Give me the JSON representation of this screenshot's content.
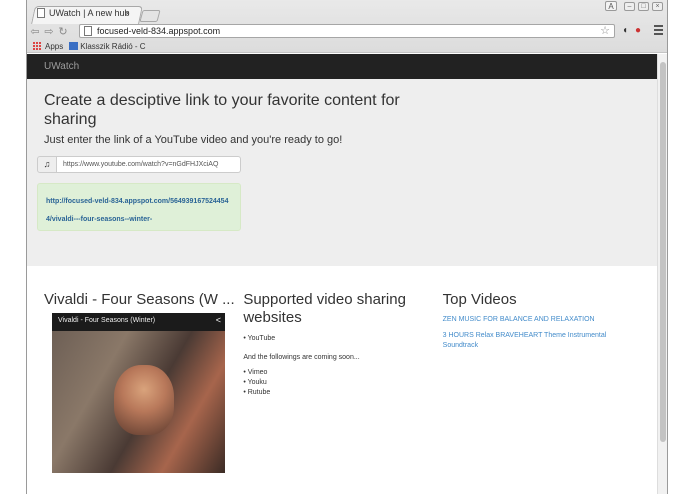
{
  "browser": {
    "tab_title": "UWatch | A new hub",
    "tab_close": "×",
    "profile_label": "A",
    "url": "focused-veld-834.appspot.com",
    "bookmarks": [
      {
        "label": "Apps"
      },
      {
        "label": "Klasszik Rádió - C"
      }
    ]
  },
  "navbar": {
    "brand": "UWatch"
  },
  "jumbotron": {
    "title": "Create a desciptive link to your favorite content for sharing",
    "subtitle": "Just enter the link of a YouTube video and you're ready to go!",
    "input_icon": "music-icon",
    "input_value": "https://www.youtube.com/watch?v=nGdFHJXciAQ",
    "result_link": "http://focused-veld-834.appspot.com/5649391675244544/vivaldi---four-seasons--winter-"
  },
  "column_video": {
    "heading": "Vivaldi - Four Seasons (W ...",
    "video_title": "Vivaldi - Four Seasons (Winter)"
  },
  "column_supported": {
    "heading": "Supported video sharing websites",
    "supported": [
      "YouTube"
    ],
    "coming_label": "And the followings are coming soon...",
    "coming": [
      "Vimeo",
      "Youku",
      "Rutube"
    ]
  },
  "column_top": {
    "heading": "Top Videos",
    "videos": [
      "ZEN MUSIC FOR BALANCE AND RELAXATION",
      "3 HOURS Relax BRAVEHEART Theme Instrumental Soundtrack"
    ]
  },
  "colors": {
    "navbar_bg": "#222222",
    "jumbotron_bg": "#eeeeee",
    "alert_bg": "#dff0d8",
    "link": "#428bca"
  }
}
